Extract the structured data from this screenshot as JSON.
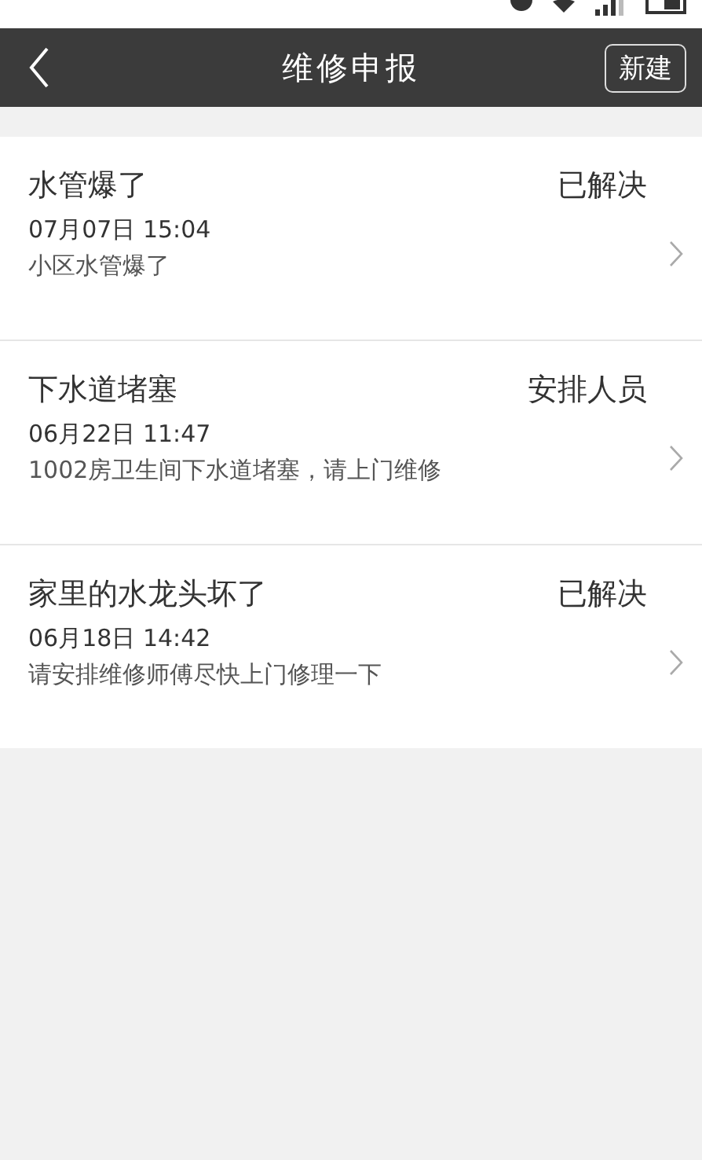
{
  "nav_bar": {
    "title": "维修申报",
    "new_button": "新建"
  },
  "requests": [
    {
      "title": "水管爆了",
      "status": "已解决",
      "time": "07月07日 15:04",
      "description": "小区水管爆了"
    },
    {
      "title": "下水道堵塞",
      "status": "安排人员",
      "time": "06月22日 11:47",
      "description": "1002房卫生间下水道堵塞，请上门维修"
    },
    {
      "title": "家里的水龙头坏了",
      "status": "已解决",
      "time": "06月18日 14:42",
      "description": "请安排维修师傅尽快上门修理一下"
    }
  ]
}
